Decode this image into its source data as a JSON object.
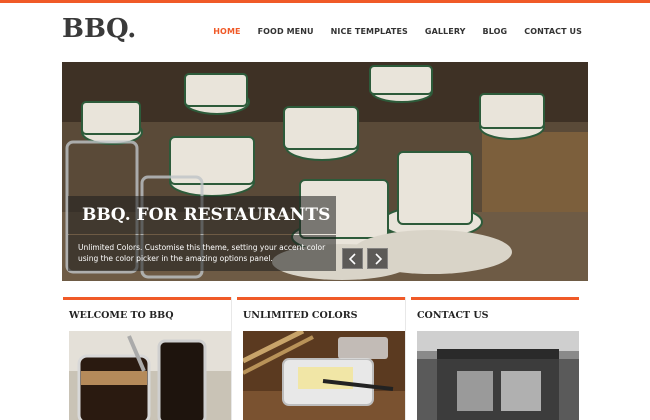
{
  "brand": {
    "logo": "BBQ."
  },
  "nav": {
    "items": [
      {
        "label": "HOME",
        "active": true
      },
      {
        "label": "FOOD MENU",
        "active": false
      },
      {
        "label": "NICE TEMPLATES",
        "active": false
      },
      {
        "label": "GALLERY",
        "active": false
      },
      {
        "label": "BLOG",
        "active": false
      },
      {
        "label": "CONTACT US",
        "active": false
      }
    ]
  },
  "hero": {
    "title": "BBQ. FOR RESTAURANTS",
    "text": "Unlimited Colors. Customise this theme, setting your accent color using the color picker in the amazing options panel.",
    "prev_icon": "chevron-left-icon",
    "next_icon": "chevron-right-icon"
  },
  "columns": [
    {
      "heading": "WELCOME TO BBQ"
    },
    {
      "heading": "UNLIMITED COLORS"
    },
    {
      "heading": "CONTACT US"
    }
  ],
  "colors": {
    "accent": "#f05a28",
    "text": "#333333"
  }
}
